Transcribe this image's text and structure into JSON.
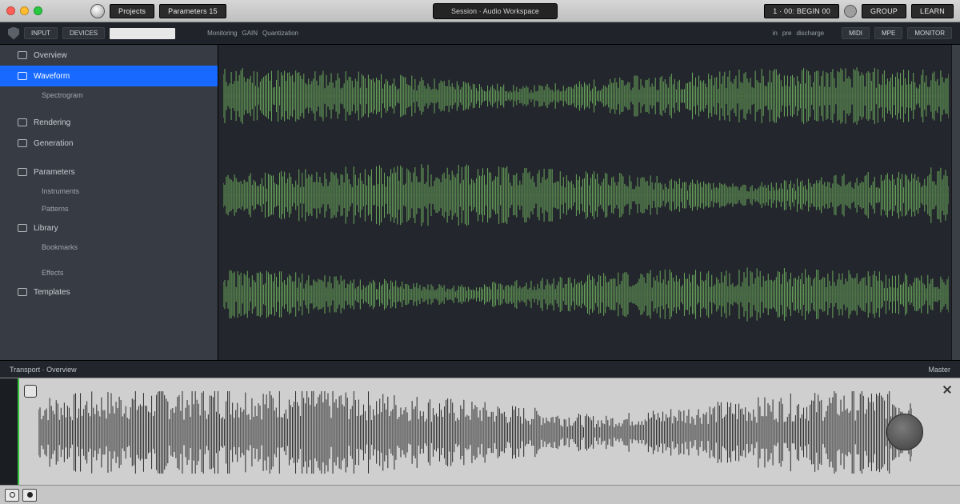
{
  "titlebar": {
    "primary_button": "Projects",
    "secondary_button": "Parameters  15",
    "center_title": "Session · Audio Workspace",
    "right_pill": "1 · 00:  BEGIN  00",
    "right_btn_a": "GROUP",
    "right_btn_b": "LEARN"
  },
  "toolbar": {
    "chip_a": "INPUT",
    "chip_b": "DEVICES",
    "search_value": "",
    "search_placeholder": "",
    "menu": [
      "Monitoring",
      "GAIN",
      "Quantization"
    ],
    "right_minis": [
      "in",
      "pre",
      "discharge"
    ],
    "right_btns": [
      "MIDI",
      "MPE",
      "MONITOR"
    ]
  },
  "sidebar": {
    "items": [
      {
        "label": "Overview",
        "kind": "row",
        "selected": false
      },
      {
        "label": "Waveform",
        "kind": "row",
        "selected": true
      },
      {
        "label": "Spectrogram",
        "kind": "sub"
      },
      {
        "label": "",
        "kind": "spacer"
      },
      {
        "label": "Rendering",
        "kind": "row"
      },
      {
        "label": "Generation",
        "kind": "row"
      },
      {
        "label": "",
        "kind": "spacer"
      },
      {
        "label": "Parameters",
        "kind": "row"
      },
      {
        "label": "Instruments",
        "kind": "sub"
      },
      {
        "label": "Patterns",
        "kind": "sub"
      },
      {
        "label": "Library",
        "kind": "row"
      },
      {
        "label": "Bookmarks",
        "kind": "sub"
      },
      {
        "label": "",
        "kind": "spacer"
      },
      {
        "label": "Effects",
        "kind": "sub"
      },
      {
        "label": "Templates",
        "kind": "row"
      }
    ]
  },
  "dock": {
    "header_left": "Transport · Overview",
    "header_right": "Master"
  },
  "colors": {
    "accent": "#1769ff",
    "wave_green": "#6fae5f",
    "activity_green": "#32c23a"
  }
}
